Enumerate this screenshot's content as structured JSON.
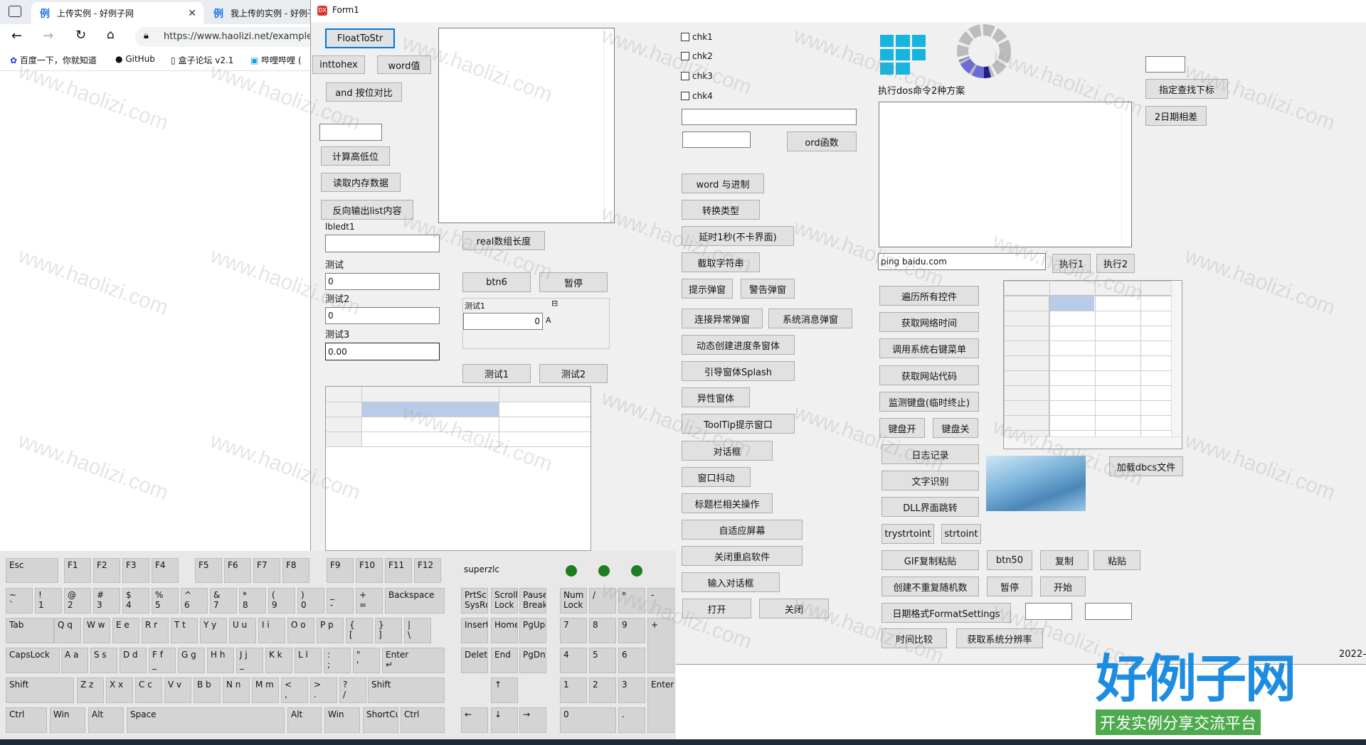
{
  "browser": {
    "tabs": [
      {
        "title": "上传实例 - 好例子网",
        "favicon": "例"
      },
      {
        "title": "我上传的实例 - 好例子",
        "favicon": "例"
      }
    ],
    "url": "https://www.haolizi.net/examples",
    "bookmarks": [
      "百度一下，你就知道",
      "GitHub",
      "盒子论坛 v2.1",
      "哔哩哔哩 ("
    ]
  },
  "form": {
    "title": "Form1",
    "col1": {
      "float_to_str": "FloatToStr",
      "inttohex": "inttohex",
      "word_value": "word值",
      "and_compare": "and 按位对比",
      "calc_high_low": "计算高低位",
      "read_memory": "读取内存数据",
      "reverse_list": "反向输出list内容",
      "lbledt1": "lbledt1",
      "test_label": "测试",
      "test_value": "0",
      "test2_label": "测试2",
      "test2_value": "0",
      "test3_label": "测试3",
      "test3_value": "0.00"
    },
    "col2": {
      "real_array_len": "real数组长度",
      "btn6": "btn6",
      "pause": "暂停",
      "spin_label": "测试1",
      "spin_value": "0",
      "spin_suffix": "A",
      "test1": "测试1",
      "test2": "测试2"
    },
    "col3": {
      "checkboxes": [
        "chk1",
        "chk2",
        "chk3",
        "chk4"
      ],
      "ord_func": "ord函数",
      "buttons": [
        "word 与进制",
        "转换类型",
        "延时1秒(不卡界面)",
        "截取字符串",
        "提示弹窗",
        "警告弹窗",
        "连接异常弹窗",
        "系统消息弹窗",
        "动态创建进度条窗体",
        "引导窗体Splash",
        "异性窗体",
        "ToolTip提示窗口",
        "对话框",
        "窗口抖动",
        "标题栏相关操作",
        "自适应屏幕",
        "关闭重启软件",
        "输入对话框",
        "打开",
        "关闭"
      ]
    },
    "col4": {
      "dos_label": "执行dos命令2种方案",
      "ping_value": "ping baidu.com",
      "exec1": "执行1",
      "exec2": "执行2",
      "buttons": [
        "遍历所有控件",
        "获取网络时间",
        "调用系统右键菜单",
        "获取网站代码",
        "监测键盘(临时终止)",
        "键盘开",
        "键盘关",
        "日志记录",
        "文字识别",
        "DLL界面跳转",
        "trystrtoint",
        "strtoint",
        "GIF复制粘贴",
        "btn50",
        "复制",
        "粘贴",
        "创建不重复随机数",
        "暂停",
        "开始",
        "日期格式FormatSettings",
        "时间比较",
        "获取系统分辨率"
      ],
      "load_dbcs": "加载dbcs文件"
    },
    "col5": {
      "find_index": "指定查找下标",
      "date_diff": "2日期相差"
    },
    "date_stub": "2022—"
  },
  "keyboard": {
    "rows": [
      [
        "Esc",
        "F1",
        "F2",
        "F3",
        "F4",
        "F5",
        "F6",
        "F7",
        "F8",
        "F9",
        "F10",
        "F11",
        "F12"
      ],
      [
        "~\n`",
        "!\n1",
        "@\n2",
        "#\n3",
        "$\n4",
        "%\n5",
        "^\n6",
        "&\n7",
        "*\n8",
        "(\n9",
        ")\n0",
        "_\n-",
        "+\n=",
        "Backspace"
      ],
      [
        "Tab",
        "Q q",
        "W w",
        "E e",
        "R r",
        "T t",
        "Y y",
        "U u",
        "I i",
        "O o",
        "P p",
        "{\n[",
        "}\n]",
        "|\n\\"
      ],
      [
        "CapsLock",
        "A a",
        "S s",
        "D d",
        "F f\n_",
        "G g",
        "H h",
        "J j\n_",
        "K k",
        "L l",
        ":\n;",
        "\"\n'",
        "Enter\n↵"
      ],
      [
        "Shift",
        "Z z",
        "X x",
        "C c",
        "V v",
        "B b",
        "N n",
        "M m",
        "<\n,",
        ">\n.",
        "?\n/",
        "Shift"
      ],
      [
        "Ctrl",
        "Win",
        "Alt",
        "Space",
        "Alt",
        "Win",
        "ShortCu",
        "Ctrl"
      ]
    ],
    "user": "superzlc",
    "nav": [
      "PrtScr\nSysRq",
      "Scroll\nLock",
      "Pause\nBreak",
      "Insert",
      "Home",
      "PgUp",
      "Delete",
      "End",
      "PgDn",
      "↑",
      "←",
      "↓",
      "→"
    ],
    "numpad": [
      "Num\nLock",
      "/",
      "*",
      "-",
      "7",
      "8",
      "9",
      "+",
      "4",
      "5",
      "6",
      "1",
      "2",
      "3",
      "Enter",
      "0",
      "."
    ]
  },
  "watermark": {
    "text": "www.haolizi.com",
    "logo_big": "好例子网",
    "logo_small": "开发实例分享交流平台"
  }
}
